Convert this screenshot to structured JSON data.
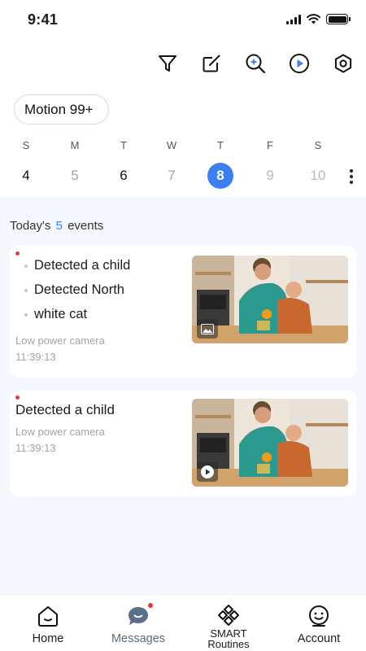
{
  "status_bar": {
    "time": "9:41"
  },
  "toolbar": {
    "icons": [
      "filter-icon",
      "edit-icon",
      "ai-search-icon",
      "play-icon",
      "settings-icon"
    ]
  },
  "filter_chip": {
    "label": "Motion 99+"
  },
  "calendar": {
    "days": [
      {
        "name": "S",
        "date": "4"
      },
      {
        "name": "M",
        "date": "5"
      },
      {
        "name": "T",
        "date": "6"
      },
      {
        "name": "W",
        "date": "7"
      },
      {
        "name": "T",
        "date": "8",
        "selected": true
      },
      {
        "name": "F",
        "date": "9"
      },
      {
        "name": "S",
        "date": "10"
      }
    ]
  },
  "summary": {
    "prefix": "Today's",
    "count": "5",
    "suffix": "events"
  },
  "events": [
    {
      "tags": [
        "Detected a child",
        "Detected North",
        "white cat"
      ],
      "camera": "Low power camera",
      "time": "11:39:13",
      "media_type": "image-icon"
    },
    {
      "title": "Detected a child",
      "camera": "Low power camera",
      "time": "11:39:13",
      "media_type": "play-icon"
    }
  ],
  "bottom_nav": [
    {
      "label": "Home",
      "icon": "home-icon"
    },
    {
      "label": "Messages",
      "icon": "messages-icon",
      "active": true
    },
    {
      "label_line1": "SMART",
      "label_line2": "Routines",
      "icon": "smart-routines-icon"
    },
    {
      "label": "Account",
      "icon": "account-icon"
    }
  ],
  "colors": {
    "accent": "#3b7ff0",
    "alert": "#e53935",
    "background": "#f4f7fd"
  }
}
